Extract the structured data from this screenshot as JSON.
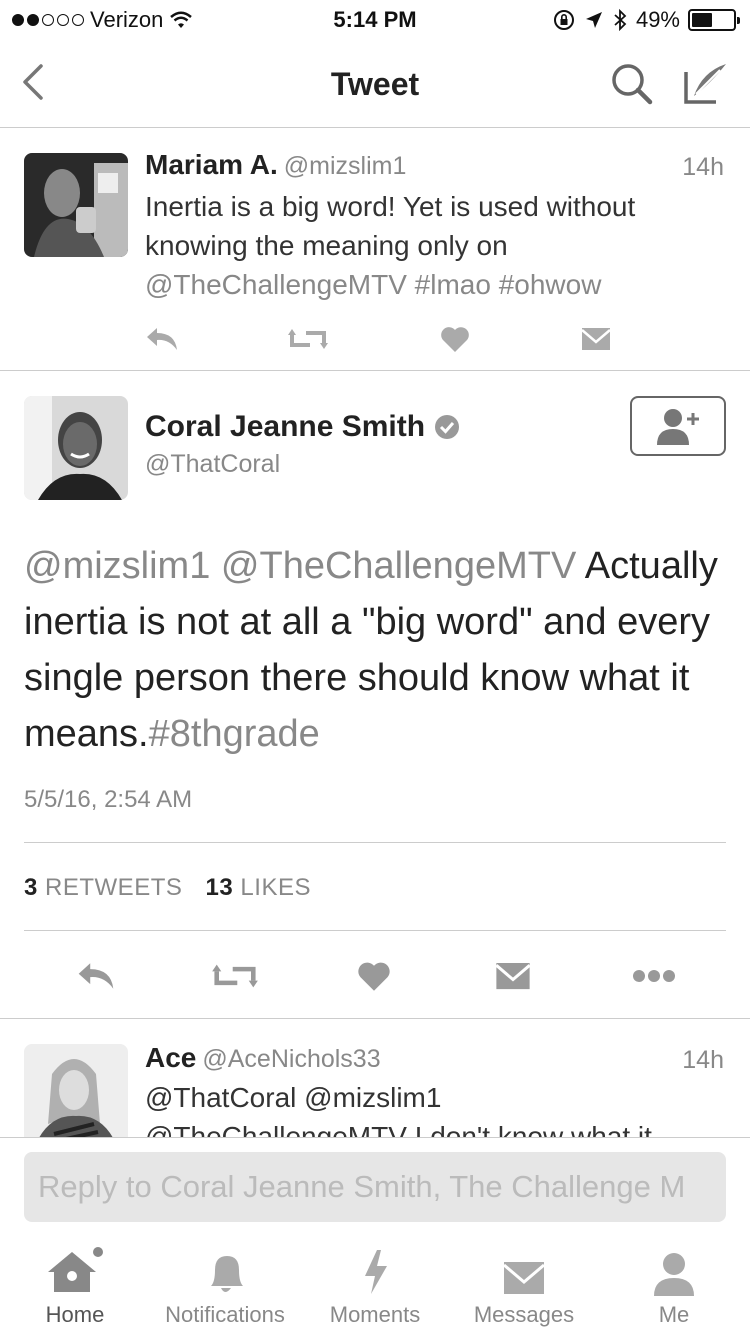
{
  "status_bar": {
    "carrier": "Verizon",
    "time": "5:14 PM",
    "battery_percent": "49%",
    "battery_level": 0.49,
    "signal_bars_filled": 2,
    "signal_bars_total": 5
  },
  "nav": {
    "title": "Tweet"
  },
  "tweet_above": {
    "name": "Mariam A.",
    "handle": "@mizslim1",
    "time": "14h",
    "text_plain": "Inertia is a big word! Yet is used without knowing the meaning only on",
    "text_link": "@TheChallengeMTV #lmao #ohwow"
  },
  "main_tweet": {
    "name": "Coral Jeanne Smith",
    "handle": "@ThatCoral",
    "body_mentions": "@mizslim1 @TheChallengeMTV",
    "body_text": "Actually inertia is not at all a \"big word\" and every single person there should know what it means.",
    "body_hashtag": "#8thgrade",
    "date": "5/5/16, 2:54 AM",
    "retweets_count": "3",
    "retweets_label": "RETWEETS",
    "likes_count": "13",
    "likes_label": "LIKES"
  },
  "reply_tweet": {
    "name": "Ace",
    "handle": "@AceNichols33",
    "time": "14h",
    "line1": "@ThatCoral @mizslim1",
    "line2": "@TheChallengeMTV I don't know what it"
  },
  "reply_box": {
    "placeholder": "Reply to Coral Jeanne Smith, The Challenge M"
  },
  "tab_bar": {
    "home": "Home",
    "notifications": "Notifications",
    "moments": "Moments",
    "messages": "Messages",
    "me": "Me"
  },
  "colors": {
    "text": "#333333",
    "muted": "#888888",
    "divider": "#cccccc",
    "icon": "#9a9a9a"
  }
}
